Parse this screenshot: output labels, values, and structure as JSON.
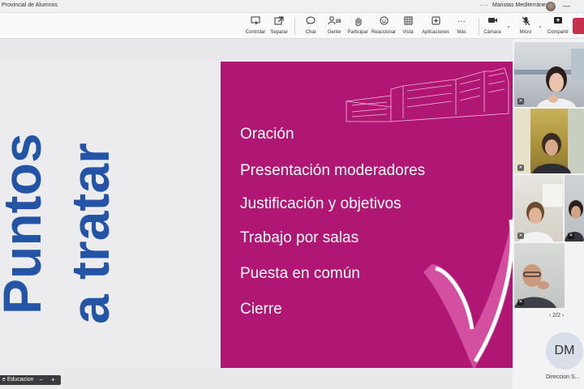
{
  "window": {
    "meeting_title": "Provincial de Alumnos",
    "organization": "Maristas Mediterránea",
    "more_icon": "ellipsis-icon"
  },
  "toolbar": {
    "items": [
      {
        "label": "Controlar",
        "icon": "control-icon"
      },
      {
        "label": "Separar",
        "icon": "popout-icon"
      },
      {
        "label": "Chat",
        "icon": "chat-icon"
      },
      {
        "label": "Gente",
        "icon": "people-icon",
        "count": "28"
      },
      {
        "label": "Participar",
        "icon": "raise-hand-icon"
      },
      {
        "label": "Reaccionar",
        "icon": "smile-icon"
      },
      {
        "label": "Vista",
        "icon": "grid-view-icon"
      },
      {
        "label": "Aplicaciones",
        "icon": "plus-icon"
      },
      {
        "label": "Más",
        "icon": "ellipsis-icon"
      },
      {
        "label": "Cámara",
        "icon": "camera-icon"
      },
      {
        "label": "Micro",
        "icon": "mic-off-icon"
      },
      {
        "label": "Compartir",
        "icon": "share-icon"
      }
    ]
  },
  "slide": {
    "title_line1": "Puntos",
    "title_line2": "a tratar",
    "agenda": [
      "Oración",
      "Presentación moderadores",
      "Justificación y objetivos",
      "Trabajo por salas",
      "Puesta en común",
      "Cierre"
    ]
  },
  "panel": {
    "page": "2/2",
    "presenter_initials": "DM",
    "presenter_name": "Direccion S..."
  },
  "bottom": {
    "share_label": "e Educacion",
    "zoom_out": "−",
    "zoom_in": "+"
  },
  "colors": {
    "slide_magenta": "#b01673",
    "title_blue": "#2354a5",
    "leave_red": "#c4314b"
  }
}
